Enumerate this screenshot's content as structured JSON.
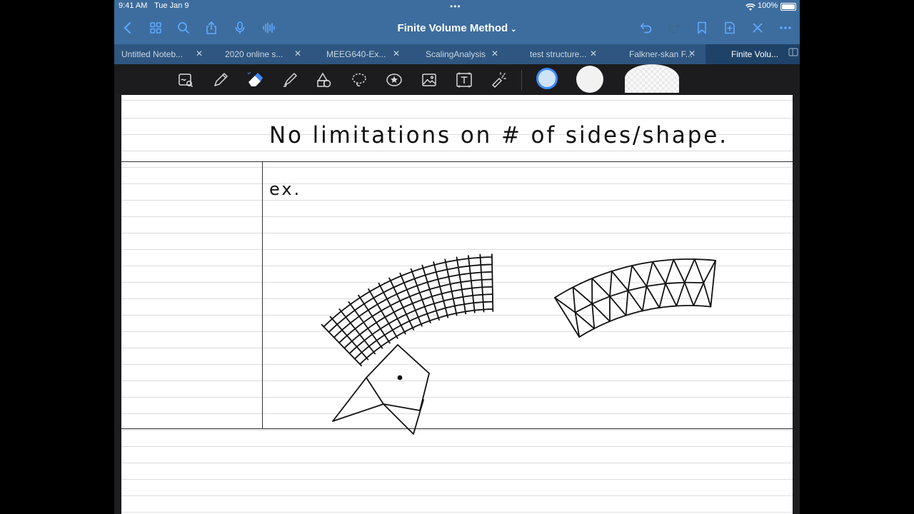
{
  "status": {
    "time": "9:41 AM",
    "date": "Tue Jan 9",
    "battery": "100%",
    "dots": "•••"
  },
  "nav": {
    "title": "Finite Volume Method",
    "icons": [
      "back-icon",
      "grid-icon",
      "search-icon",
      "share-icon",
      "microphone-icon",
      "audio-waveform-icon",
      "undo-icon",
      "redo-icon",
      "bookmark-icon",
      "add-page-icon",
      "close-icon",
      "more-icon"
    ]
  },
  "tabs": [
    {
      "label": "Untitled Noteb...",
      "active": false
    },
    {
      "label": "2020 online s...",
      "active": false
    },
    {
      "label": "MEEG640-Ex...",
      "active": false
    },
    {
      "label": "ScalingAnalysis",
      "active": false
    },
    {
      "label": "test structure...",
      "active": false
    },
    {
      "label": "Falkner-skan F...",
      "active": false
    },
    {
      "label": "Finite Volu...",
      "active": true
    }
  ],
  "toolbar": {
    "tools": [
      "zoom-window-icon",
      "pen-icon",
      "eraser-icon",
      "highlighter-icon",
      "shapes-icon",
      "lasso-icon",
      "sticker-icon",
      "image-icon",
      "text-icon",
      "laser-pointer-icon"
    ],
    "selected_tool": "eraser-icon",
    "swatches": [
      "#cfe3f7",
      "#f2f2f2",
      "#efefef"
    ]
  },
  "note": {
    "heading": "No limitations on # of sides/shape.",
    "example_label": "ex."
  },
  "colors": {
    "nav_blue": "#3d6d9e",
    "tab_blue": "#2e5680",
    "active_tab": "#1f4268",
    "toolbar": "#1c1c1e",
    "ink": "#111111"
  }
}
